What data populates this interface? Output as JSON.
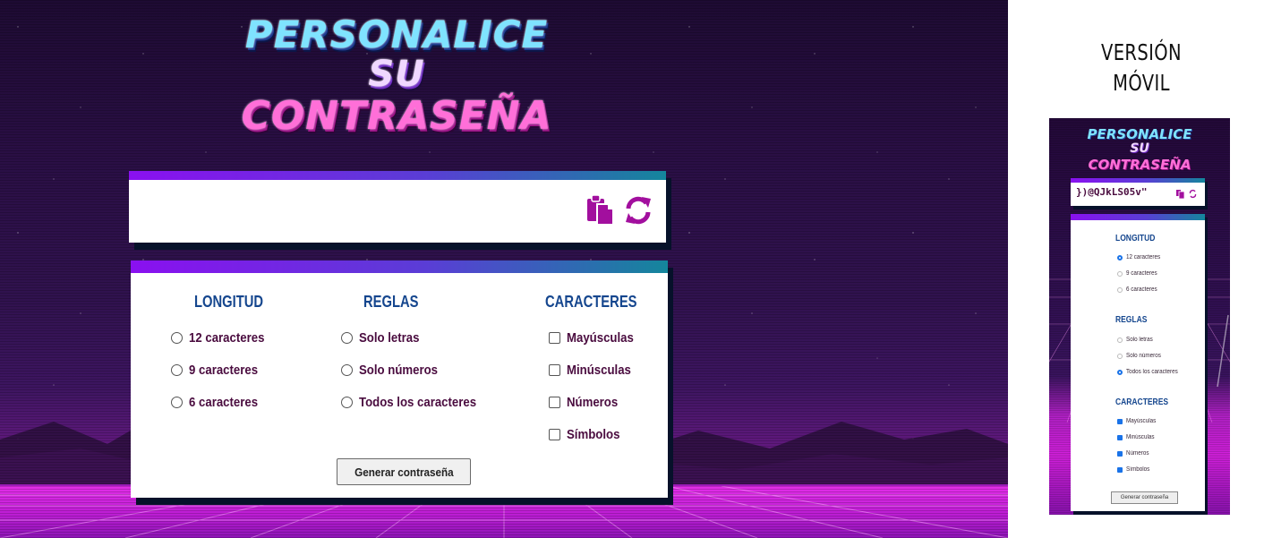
{
  "logo": {
    "line1": "PERSONALICE",
    "line2": "SU",
    "line3": "CONTRASEÑA"
  },
  "password": {
    "value": "",
    "copy_icon": "clipboard-copy-icon",
    "refresh_icon": "refresh-icon"
  },
  "options": {
    "longitud": {
      "title": "LONGITUD",
      "items": [
        "12 caracteres",
        "9 caracteres",
        "6 caracteres"
      ]
    },
    "reglas": {
      "title": "REGLAS",
      "items": [
        "Solo letras",
        "Solo números",
        "Todos los caracteres"
      ]
    },
    "caracteres": {
      "title": "CARACTERES",
      "items": [
        "Mayúsculas",
        "Minúsculas",
        "Números",
        "Símbolos"
      ]
    },
    "generate_label": "Generar contraseña"
  },
  "mobile": {
    "heading_line1": "VERSIÓN",
    "heading_line2": "MÓVIL",
    "password_value": "})@QJkLS05v\"",
    "selected_length": "12 caracteres",
    "selected_rule": "Todos los caracteres",
    "checked_characters": [
      "Mayúsculas",
      "Minúsculas",
      "Números",
      "Símbolos"
    ]
  },
  "colors": {
    "accent_purple": "#8a10f0",
    "accent_teal": "#14869c",
    "title_blue": "#15468e",
    "label_plum": "#4a0c3f",
    "icon_magenta": "#a20f9e"
  }
}
